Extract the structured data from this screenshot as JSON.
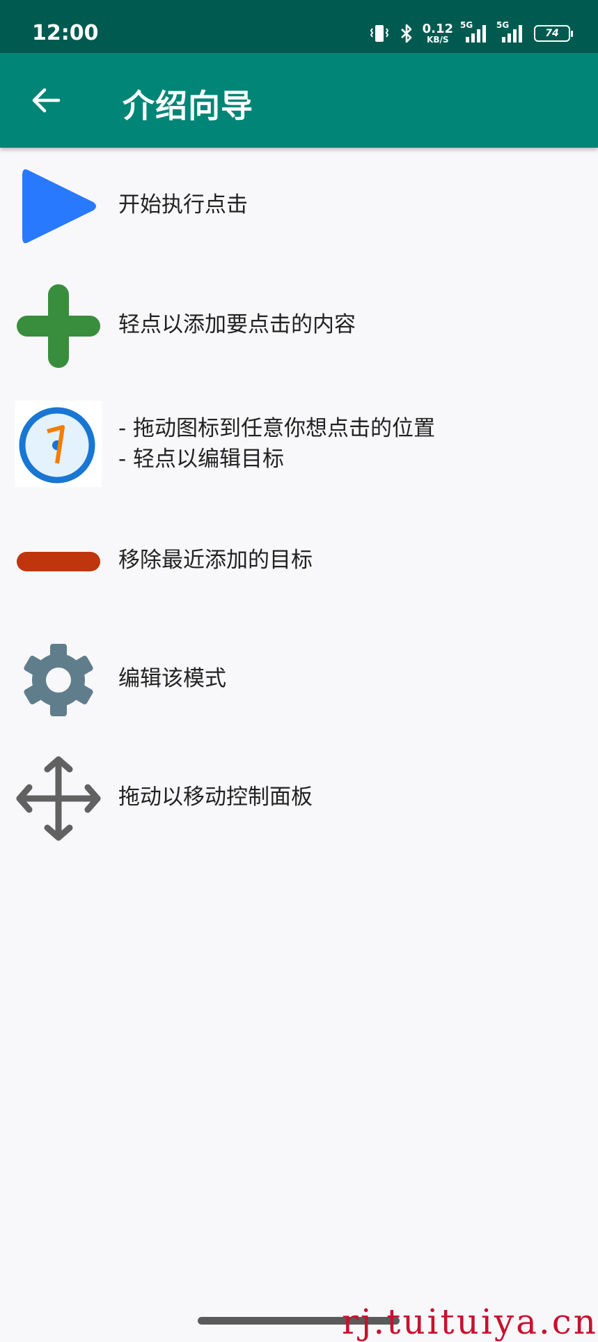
{
  "status_bar": {
    "time": "12:00",
    "net_speed_value": "0.12",
    "net_speed_unit": "KB/S",
    "sim1_tag": "5G",
    "sim2_tag": "5G",
    "battery_level": "74",
    "icons": [
      "vibrate-icon",
      "bluetooth-icon",
      "signal-icon",
      "signal-icon",
      "battery-icon"
    ]
  },
  "app_bar": {
    "title": "介绍向导",
    "back_icon": "arrow-left-icon",
    "color": "#008577"
  },
  "items": [
    {
      "icon": "play-icon",
      "label": "开始执行点击",
      "color": "#2979ff"
    },
    {
      "icon": "plus-icon",
      "label": "轻点以添加要点击的内容",
      "color": "#388e3c"
    },
    {
      "icon": "target-one-icon",
      "label": "- 拖动图标到任意你想点击的位置\n- 轻点以编辑目标",
      "color": "#1976d2"
    },
    {
      "icon": "minus-icon",
      "label": "移除最近添加的目标",
      "color": "#bf360c"
    },
    {
      "icon": "gear-icon",
      "label": "编辑该模式",
      "color": "#607d8b"
    },
    {
      "icon": "move-icon",
      "label": "拖动以移动控制面板",
      "color": "#616161"
    }
  ],
  "watermark": "rj.tuituiya.cn"
}
